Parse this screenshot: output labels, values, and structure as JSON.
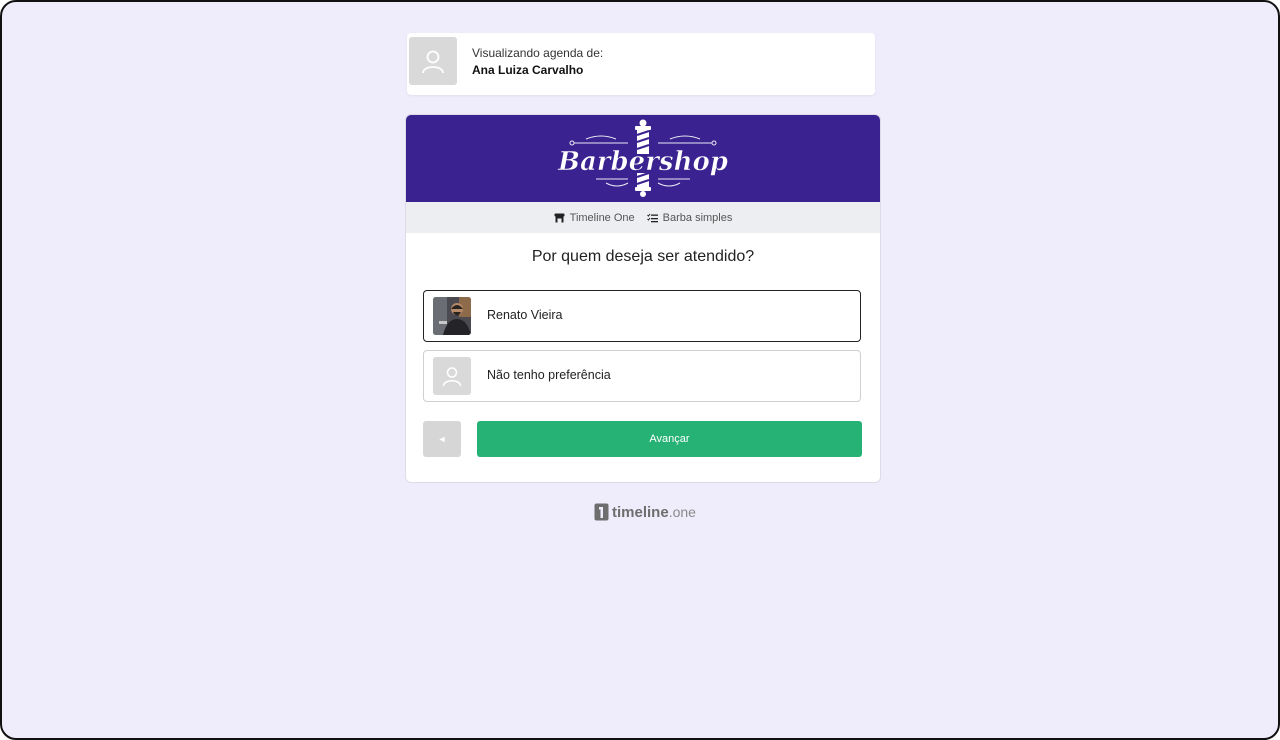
{
  "viewer": {
    "label": "Visualizando agenda de:",
    "name": "Ana Luiza Carvalho",
    "avatar_icon": "user-icon"
  },
  "banner": {
    "logo_text": "Barbershop",
    "background": "#3a2390"
  },
  "info": {
    "business": "Timeline One",
    "business_icon": "store-icon",
    "service": "Barba simples",
    "service_icon": "checklist-icon"
  },
  "question": "Por quem deseja ser atendido?",
  "options": [
    {
      "label": "Renato Vieira",
      "avatar": "professional-photo",
      "selected": true
    },
    {
      "label": "Não tenho preferência",
      "avatar": "user-icon",
      "selected": false
    }
  ],
  "actions": {
    "back_label": "◄",
    "next_label": "Avançar",
    "next_color": "#27b275"
  },
  "footer": {
    "brand_bold": "timeline",
    "brand_light": ".one"
  }
}
